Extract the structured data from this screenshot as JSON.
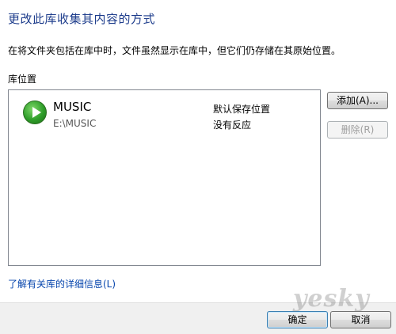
{
  "dialog": {
    "title": "更改此库收集其内容的方式",
    "description": "在将文件夹包括在库中时，文件虽然显示在库中，但它们仍存储在其原始位置。",
    "section_label": "库位置"
  },
  "library_locations": [
    {
      "name": "MUSIC",
      "path": "E:\\MUSIC",
      "status_default": "默认保存位置",
      "status_response": "没有反应",
      "icon": "play-icon"
    }
  ],
  "buttons": {
    "add": "添加(A)...",
    "remove": "删除(R)",
    "ok": "确定",
    "cancel": "取消"
  },
  "link": "了解有关库的详细信息(L)",
  "watermark": "yesky"
}
